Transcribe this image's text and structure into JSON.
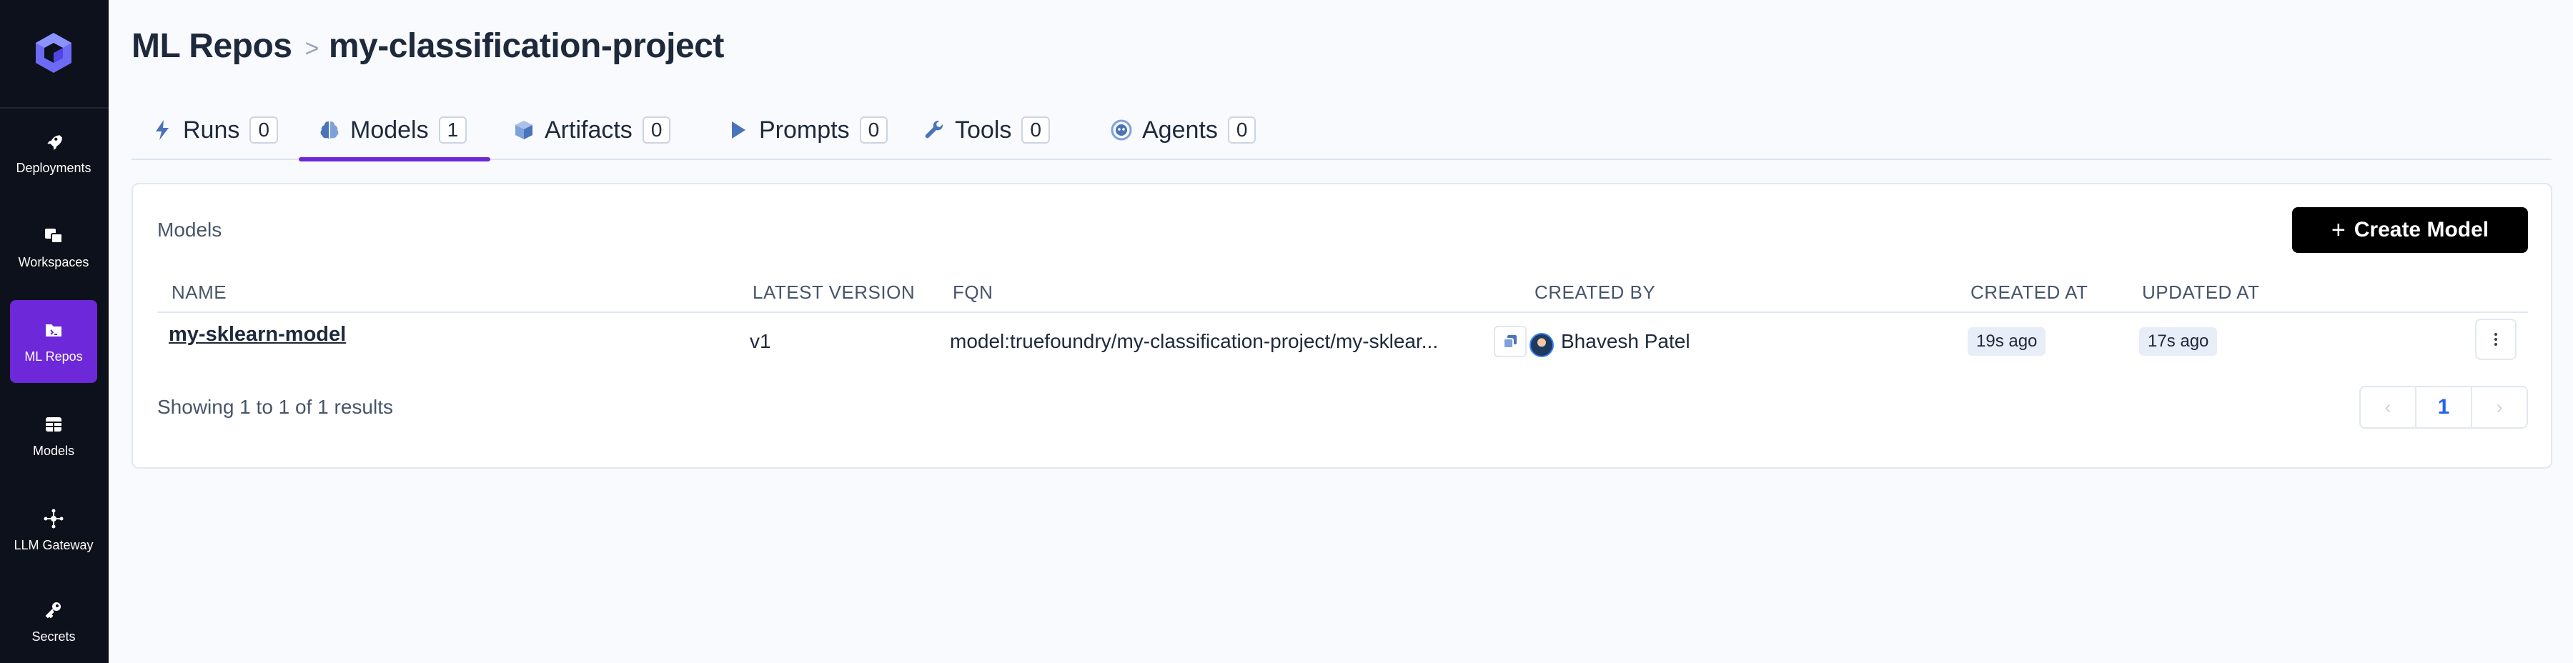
{
  "sidebar": {
    "logo_icon": "truefoundry-logo-icon",
    "items": [
      {
        "label": "Deployments",
        "icon": "rocket-icon"
      },
      {
        "label": "Workspaces",
        "icon": "workspaces-icon"
      },
      {
        "label": "ML Repos",
        "icon": "folder-icon",
        "active": true
      },
      {
        "label": "Models",
        "icon": "table-icon"
      },
      {
        "label": "LLM Gateway",
        "icon": "network-icon"
      },
      {
        "label": "Secrets",
        "icon": "key-icon"
      }
    ]
  },
  "header": {
    "breadcrumb_root": "ML Repos",
    "breadcrumb_separator": ">",
    "breadcrumb_current": "my-classification-project"
  },
  "tabs": [
    {
      "label": "Runs",
      "count": "0",
      "icon": "lightning-icon"
    },
    {
      "label": "Models",
      "count": "1",
      "icon": "brain-icon",
      "active": true
    },
    {
      "label": "Artifacts",
      "count": "0",
      "icon": "box-icon"
    },
    {
      "label": "Prompts",
      "count": "0",
      "icon": "play-icon"
    },
    {
      "label": "Tools",
      "count": "0",
      "icon": "wrench-icon"
    },
    {
      "label": "Agents",
      "count": "0",
      "icon": "agent-icon"
    }
  ],
  "models_card": {
    "title": "Models",
    "create_button": "Create Model",
    "columns": [
      "NAME",
      "LATEST VERSION",
      "FQN",
      "CREATED BY",
      "CREATED AT",
      "UPDATED AT"
    ],
    "rows": [
      {
        "name": "my-sklearn-model",
        "latest_version": "v1",
        "fqn": "model:truefoundry/my-classification-project/my-sklear...",
        "created_by": "Bhavesh Patel",
        "created_at": "19s ago",
        "updated_at": "17s ago"
      }
    ],
    "showing_text": "Showing 1 to 1 of 1 results",
    "pagination": {
      "prev": "‹",
      "current_page": "1",
      "next": "›"
    }
  },
  "colors": {
    "sidebar_bg": "#0d111b",
    "accent": "#6d28d9",
    "page_bg": "#f8fafd",
    "link_blue": "#2563eb"
  }
}
